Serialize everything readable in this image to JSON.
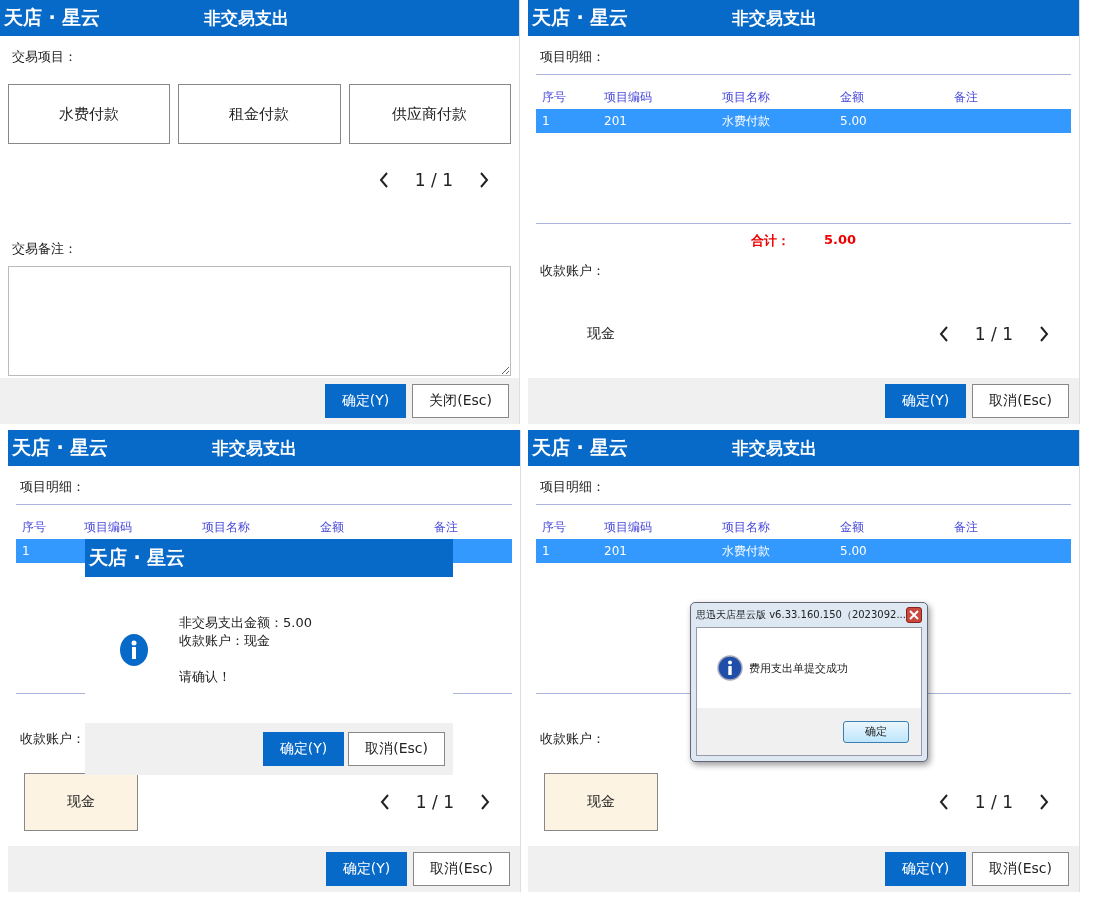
{
  "panels": [
    {
      "kind": "items",
      "logo": "天店 · 星云",
      "title": "非交易支出",
      "section_label": "交易项目：",
      "items": [
        {
          "label": "水费付款",
          "selected": false
        },
        {
          "label": "租金付款",
          "selected": false
        },
        {
          "label": "供应商付款",
          "selected": false
        }
      ],
      "pager": "1 / 1",
      "remark_label": "交易备注：",
      "buttons": [
        {
          "label": "确定(Y)",
          "primary": true
        },
        {
          "label": "关闭(Esc)",
          "primary": false
        }
      ]
    },
    {
      "kind": "detail",
      "logo": "天店 · 星云",
      "title": "非交易支出",
      "section_label": "项目明细：",
      "columns": [
        "序号",
        "项目编码",
        "项目名称",
        "金额",
        "备注"
      ],
      "rows": [
        {
          "cells": [
            "1",
            "201",
            "水费付款",
            "5.00"
          ],
          "selected": true
        }
      ],
      "total_label": "合计：",
      "total": "5.00",
      "account_label": "收款账户：",
      "accounts": [
        {
          "label": "现金",
          "selected": false
        }
      ],
      "pager": "1 / 1",
      "buttons": [
        {
          "label": "确定(Y)",
          "primary": true
        },
        {
          "label": "取消(Esc)",
          "primary": false
        }
      ]
    },
    {
      "kind": "detail",
      "logo": "天店 · 星云",
      "title": "非交易支出",
      "section_label": "项目明细：",
      "columns": [
        "序号",
        "项目编码",
        "项目名称",
        "金额",
        "备注"
      ],
      "rows": [
        {
          "cells": [
            "1"
          ],
          "selected": true
        }
      ],
      "account_label": "收款账户：",
      "accounts": [
        {
          "label": "现金",
          "selected": true
        }
      ],
      "pager": "1 / 1",
      "buttons": [
        {
          "label": "确定(Y)",
          "primary": true
        },
        {
          "label": "取消(Esc)",
          "primary": false
        }
      ],
      "dialog": {
        "kind": "confirm",
        "logo": "天店 · 星云",
        "lines": [
          "非交易支出金额：5.00",
          "收款账户：现金"
        ],
        "prompt": "请确认！",
        "buttons": [
          {
            "label": "确定(Y)",
            "primary": true
          },
          {
            "label": "取消(Esc)",
            "primary": false
          }
        ]
      }
    },
    {
      "kind": "detail",
      "logo": "天店 · 星云",
      "title": "非交易支出",
      "section_label": "项目明细：",
      "columns": [
        "序号",
        "项目编码",
        "项目名称",
        "金额",
        "备注"
      ],
      "rows": [
        {
          "cells": [
            "1",
            "201",
            "水费付款",
            "5.00"
          ],
          "selected": true
        }
      ],
      "account_label": "收款账户：",
      "accounts": [
        {
          "label": "现金",
          "selected": true
        }
      ],
      "pager": "1 / 1",
      "buttons": [
        {
          "label": "确定(Y)",
          "primary": true
        },
        {
          "label": "取消(Esc)",
          "primary": false
        }
      ],
      "dialog": {
        "kind": "message",
        "title": "思迅天店星云版 v6.33.160.150（2023092...",
        "message": "费用支出单提交成功",
        "buttons": [
          {
            "label": "确定",
            "primary": false
          }
        ]
      }
    }
  ]
}
